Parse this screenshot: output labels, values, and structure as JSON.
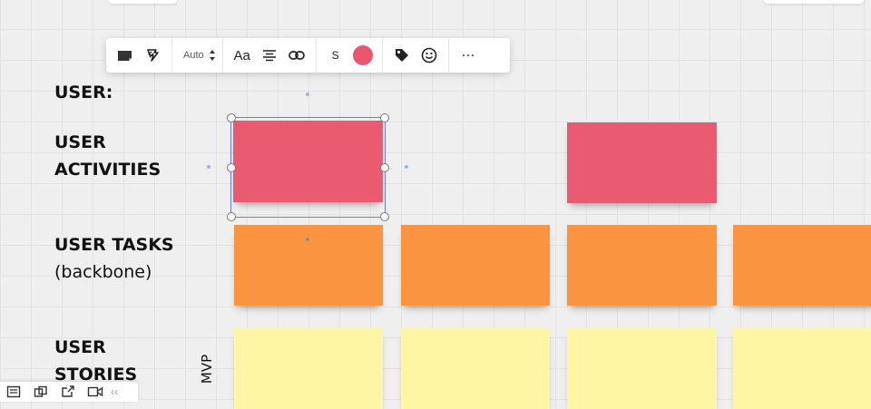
{
  "toolbar": {
    "auto_label": "Auto",
    "font_label": "Aa",
    "size_label": "S",
    "color": "#e9566e",
    "items": [
      "sticky-shape-icon",
      "sticky-style-icon",
      "stepper-icon",
      "align-center-icon",
      "link-icon",
      "tag-icon",
      "emoji-icon",
      "more-icon"
    ]
  },
  "labels": {
    "user": "USER:",
    "activities_line1": "USER",
    "activities_line2": "ACTIVITIES",
    "tasks_line1": "USER TASKS",
    "tasks_line2": "(backbone)",
    "stories_line1": "USER",
    "stories_line2": "STORIES",
    "mvp": "MVP"
  },
  "colors": {
    "activity_sticky": "#ea5b72",
    "task_sticky": "#fb9440",
    "story_sticky": "#fef6a4",
    "selection": "#6b7fd6"
  },
  "bottom_bar": {
    "collapse_label": "‹‹",
    "icons": [
      "board-list-icon",
      "frames-icon",
      "share-icon",
      "video-icon"
    ]
  }
}
